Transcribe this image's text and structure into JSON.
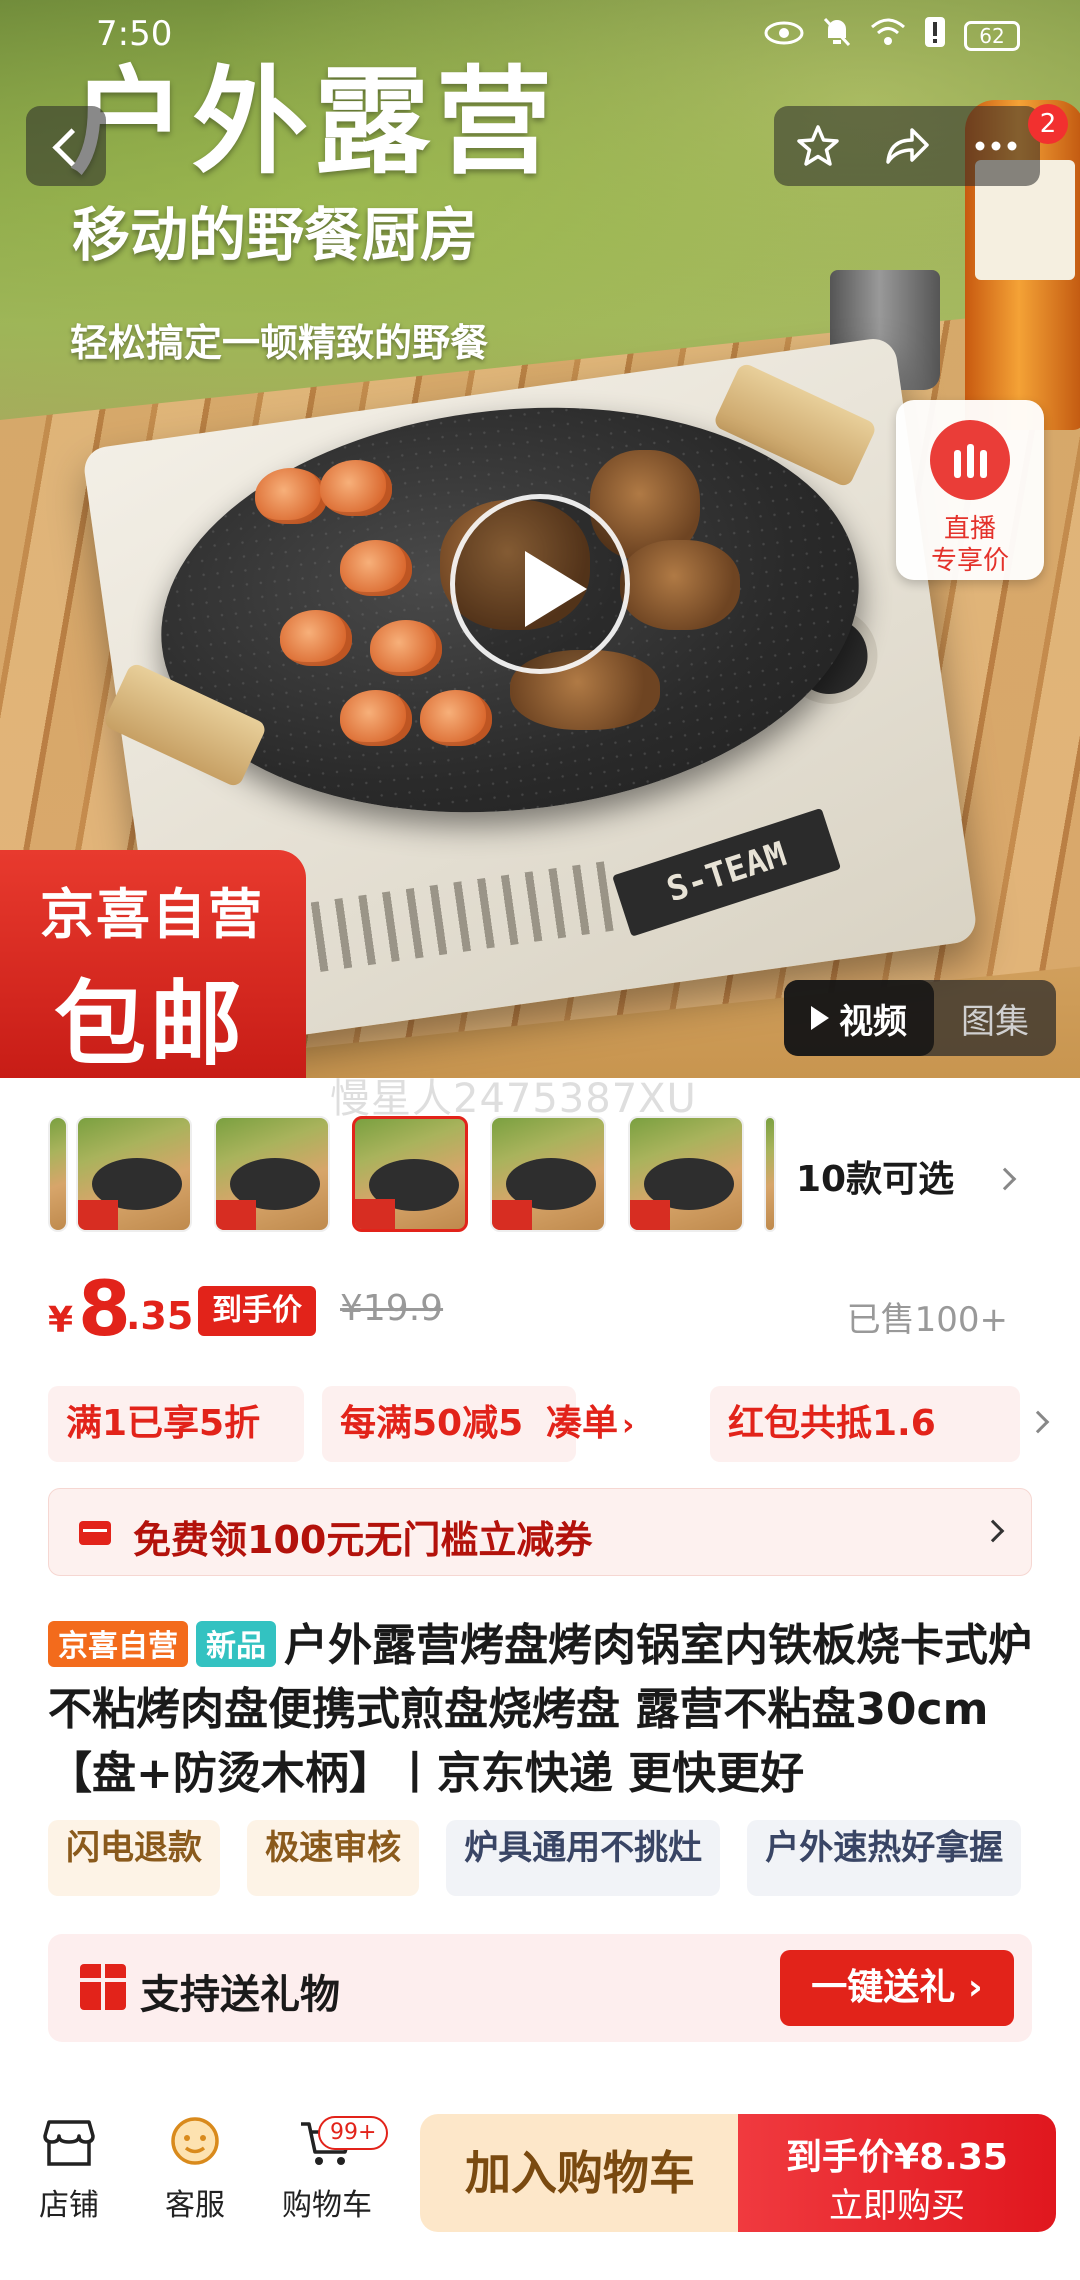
{
  "status_bar": {
    "time": "7:50",
    "battery": "62"
  },
  "hero": {
    "title": "户外露营",
    "subtitle": "移动的野餐厨房",
    "subtitle2": "轻松搞定一顿精致的野餐",
    "stove_brand": "S-TEAM",
    "badge_line1": "京喜自营",
    "badge_line2": "包邮",
    "media_video": "视频",
    "media_gallery": "图集",
    "live_line1": "直播",
    "live_line2": "专享价",
    "cart_count": "2",
    "watermark": "慢星人2475387XU"
  },
  "thumbnails": {
    "variants_label": "10款可选"
  },
  "price": {
    "currency": "¥",
    "integer": "8",
    "decimal": ".35",
    "tag": "到手价",
    "original": "¥19.9",
    "sold": "已售100+"
  },
  "promos": [
    {
      "text": "满1已享5折"
    },
    {
      "text": "每满50减5",
      "action": "凑单"
    },
    {
      "text": "红包共抵1.6"
    }
  ],
  "coupon": {
    "text": "免费领100元无门槛立减券"
  },
  "product": {
    "tag1": "京喜自营",
    "tag2": "新品",
    "title": "户外露营烤盘烤肉锅室内铁板烧卡式炉不粘烤肉盘便携式煎盘烧烤盘 露营不粘盘30cm【盘+防烫木柄】丨京东快递 更快更好"
  },
  "features": [
    "闪电退款",
    "极速审核",
    "炉具通用不挑灶",
    "户外速热好拿握"
  ],
  "gift": {
    "text": "支持送礼物",
    "button": "一键送礼"
  },
  "bottom_bar": {
    "store": "店铺",
    "service": "客服",
    "cart": "购物车",
    "cart_badge": "99+",
    "add_cart": "加入购物车",
    "buy_price_label": "到手价",
    "buy_price": "¥8.35",
    "buy_now": "立即购买"
  },
  "colors": {
    "accent": "#e2231a",
    "cart_button": "#fde7c9",
    "buy_button": "#e0171e"
  }
}
